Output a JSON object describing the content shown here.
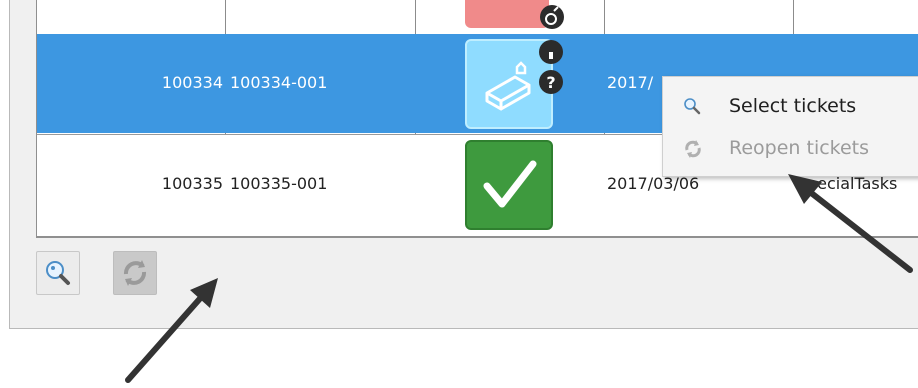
{
  "rows": [
    {
      "id": "",
      "code": "",
      "date": "",
      "type": ""
    },
    {
      "id": "100334",
      "code": "100334-001",
      "date": "2017/",
      "type": ""
    },
    {
      "id": "100335",
      "code": "100335-001",
      "date": "2017/03/06",
      "type": "pecialTasks"
    }
  ],
  "context_menu": {
    "items": [
      {
        "label": "Select tickets",
        "icon": "search-icon",
        "enabled": true
      },
      {
        "label": "Reopen tickets",
        "icon": "reopen-icon",
        "enabled": false
      }
    ]
  },
  "toolbar": {
    "search_button_icon": "search-icon",
    "refresh_button_icon": "refresh-icon"
  },
  "colors": {
    "selected_row": "#3d97e1",
    "status_new": "#7fd2ff",
    "status_done": "#3e9a3e",
    "status_red": "#f08888"
  }
}
